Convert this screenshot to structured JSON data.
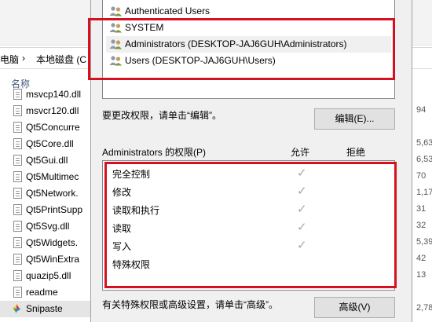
{
  "explorer": {
    "breadcrumb": [
      "电脑",
      "本地磁盘 (C"
    ],
    "column_header": "名称",
    "files": [
      {
        "name": "msvcp140.dll",
        "icon": "dll-file-icon"
      },
      {
        "name": "msvcr120.dll",
        "icon": "dll-file-icon"
      },
      {
        "name": "Qt5Concurre",
        "icon": "dll-file-icon"
      },
      {
        "name": "Qt5Core.dll",
        "icon": "dll-file-icon"
      },
      {
        "name": "Qt5Gui.dll",
        "icon": "dll-file-icon"
      },
      {
        "name": "Qt5Multimec",
        "icon": "dll-file-icon"
      },
      {
        "name": "Qt5Network.",
        "icon": "dll-file-icon"
      },
      {
        "name": "Qt5PrintSupp",
        "icon": "dll-file-icon"
      },
      {
        "name": "Qt5Svg.dll",
        "icon": "dll-file-icon"
      },
      {
        "name": "Qt5Widgets.",
        "icon": "dll-file-icon"
      },
      {
        "name": "Qt5WinExtra",
        "icon": "dll-file-icon"
      },
      {
        "name": "quazip5.dll",
        "icon": "dll-file-icon"
      },
      {
        "name": "readme",
        "icon": "text-file-icon"
      },
      {
        "name": "Snipaste",
        "icon": "snipaste-app-icon"
      }
    ],
    "sizes": [
      "",
      "94",
      "",
      "5,63",
      "6,53",
      "70",
      "1,17",
      "31",
      "32",
      "5,39",
      "42",
      "13",
      "",
      "2,78"
    ]
  },
  "dialog": {
    "users": [
      {
        "name": "Authenticated Users",
        "icon": "user-group-icon"
      },
      {
        "name": "SYSTEM",
        "icon": "user-group-icon"
      },
      {
        "name": "Administrators (DESKTOP-JAJ6GUH\\Administrators)",
        "icon": "user-group-icon"
      },
      {
        "name": "Users (DESKTOP-JAJ6GUH\\Users)",
        "icon": "user-group-icon"
      }
    ],
    "change_hint": "要更改权限，请单击“编辑”。",
    "edit_button": "编辑(E)...",
    "perm_label": "Administrators 的权限(P)",
    "allow_header": "允许",
    "deny_header": "拒绝",
    "permissions": [
      {
        "name": "完全控制",
        "allow": true
      },
      {
        "name": "修改",
        "allow": true
      },
      {
        "name": "读取和执行",
        "allow": true
      },
      {
        "name": "读取",
        "allow": true
      },
      {
        "name": "写入",
        "allow": true
      },
      {
        "name": "特殊权限",
        "allow": false
      }
    ],
    "advanced_hint": "有关特殊权限或高级设置，请单击“高级”。",
    "advanced_button": "高级(V)",
    "check_glyph": "✓"
  },
  "colors": {
    "highlight_frame": "#d6111f",
    "check": "#a8a8a8"
  }
}
